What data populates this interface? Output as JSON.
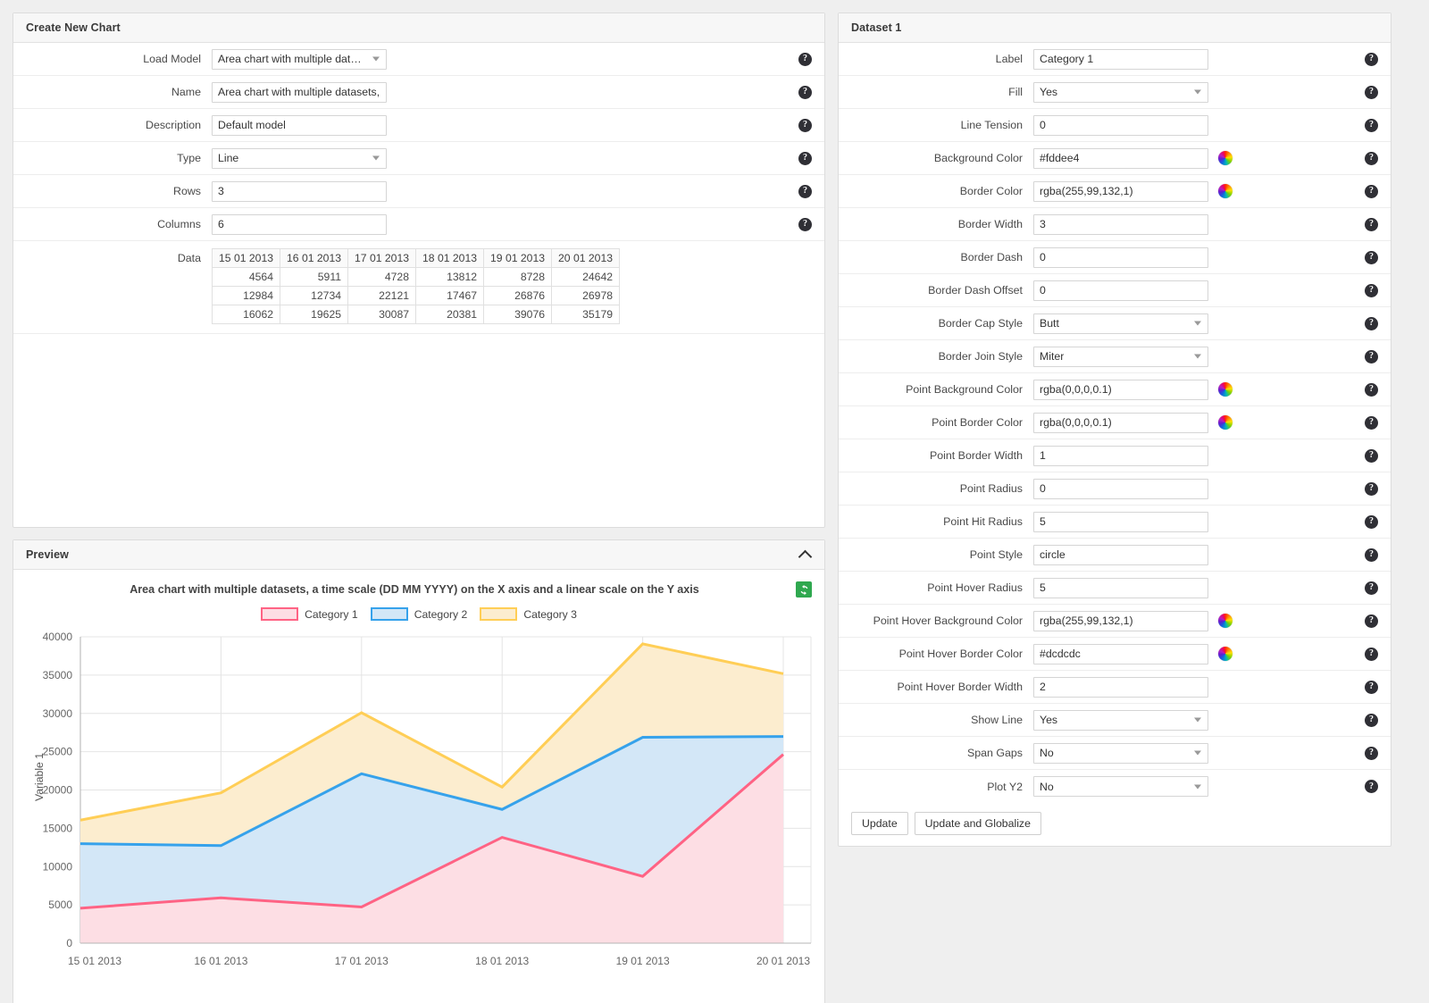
{
  "left_panel": {
    "title": "Create New Chart",
    "fields": [
      {
        "label": "Load Model",
        "value": "Area chart with multiple datase...",
        "control": "select"
      },
      {
        "label": "Name",
        "value": "Area chart with multiple datasets, a tim",
        "control": "input"
      },
      {
        "label": "Description",
        "value": "Default model",
        "control": "input"
      },
      {
        "label": "Type",
        "value": "Line",
        "control": "select"
      },
      {
        "label": "Rows",
        "value": "3",
        "control": "input"
      },
      {
        "label": "Columns",
        "value": "6",
        "control": "input"
      }
    ],
    "data_label": "Data",
    "help_icon": "question-mark-icon"
  },
  "data_table": {
    "headers": [
      "15 01 2013",
      "16 01 2013",
      "17 01 2013",
      "18 01 2013",
      "19 01 2013",
      "20 01 2013"
    ],
    "rows": [
      [
        "4564",
        "5911",
        "4728",
        "13812",
        "8728",
        "24642"
      ],
      [
        "12984",
        "12734",
        "22121",
        "17467",
        "26876",
        "26978"
      ],
      [
        "16062",
        "19625",
        "30087",
        "20381",
        "39076",
        "35179"
      ]
    ]
  },
  "preview": {
    "title": "Preview",
    "collapse_icon": "chevron-up-icon",
    "refresh_icon": "refresh-icon",
    "refresh_color": "#2fa84f"
  },
  "right_panel": {
    "title": "Dataset 1",
    "fields": [
      {
        "label": "Label",
        "value": "Category 1",
        "control": "input",
        "swatch": false
      },
      {
        "label": "Fill",
        "value": "Yes",
        "control": "select",
        "swatch": false
      },
      {
        "label": "Line Tension",
        "value": "0",
        "control": "input",
        "swatch": false
      },
      {
        "label": "Background Color",
        "value": "#fddee4",
        "control": "input",
        "swatch": true
      },
      {
        "label": "Border Color",
        "value": "rgba(255,99,132,1)",
        "control": "input",
        "swatch": true
      },
      {
        "label": "Border Width",
        "value": "3",
        "control": "input",
        "swatch": false
      },
      {
        "label": "Border Dash",
        "value": "0",
        "control": "input",
        "swatch": false
      },
      {
        "label": "Border Dash Offset",
        "value": "0",
        "control": "input",
        "swatch": false
      },
      {
        "label": "Border Cap Style",
        "value": "Butt",
        "control": "select",
        "swatch": false
      },
      {
        "label": "Border Join Style",
        "value": "Miter",
        "control": "select",
        "swatch": false
      },
      {
        "label": "Point Background Color",
        "value": "rgba(0,0,0,0.1)",
        "control": "input",
        "swatch": true
      },
      {
        "label": "Point Border Color",
        "value": "rgba(0,0,0,0.1)",
        "control": "input",
        "swatch": true
      },
      {
        "label": "Point Border Width",
        "value": "1",
        "control": "input",
        "swatch": false
      },
      {
        "label": "Point Radius",
        "value": "0",
        "control": "input",
        "swatch": false
      },
      {
        "label": "Point Hit Radius",
        "value": "5",
        "control": "input",
        "swatch": false
      },
      {
        "label": "Point Style",
        "value": "circle",
        "control": "input",
        "swatch": false
      },
      {
        "label": "Point Hover Radius",
        "value": "5",
        "control": "input",
        "swatch": false
      },
      {
        "label": "Point Hover Background Color",
        "value": "rgba(255,99,132,1)",
        "control": "input",
        "swatch": true
      },
      {
        "label": "Point Hover Border Color",
        "value": "#dcdcdc",
        "control": "input",
        "swatch": true
      },
      {
        "label": "Point Hover Border Width",
        "value": "2",
        "control": "input",
        "swatch": false
      },
      {
        "label": "Show Line",
        "value": "Yes",
        "control": "select",
        "swatch": false
      },
      {
        "label": "Span Gaps",
        "value": "No",
        "control": "select",
        "swatch": false
      },
      {
        "label": "Plot Y2",
        "value": "No",
        "control": "select",
        "swatch": false
      }
    ],
    "buttons": [
      {
        "label": "Update"
      },
      {
        "label": "Update and Globalize"
      }
    ]
  },
  "chart_data": {
    "type": "area",
    "title": "Area chart with multiple datasets, a time scale (DD MM YYYY) on the X axis and a linear scale on the Y axis",
    "xlabel": "",
    "ylabel": "Variable 1",
    "x": [
      "15 01 2013",
      "16 01 2013",
      "17 01 2013",
      "18 01 2013",
      "19 01 2013",
      "20 01 2013"
    ],
    "ylim": [
      0,
      40000
    ],
    "yticks": [
      0,
      5000,
      10000,
      15000,
      20000,
      25000,
      30000,
      35000,
      40000
    ],
    "grid": true,
    "legend_position": "top",
    "stacked": false,
    "series": [
      {
        "name": "Category 1",
        "values": [
          4564,
          5911,
          4728,
          13812,
          8728,
          24642
        ],
        "border_color": "rgba(255,99,132,1)",
        "fill_color": "#fddee4"
      },
      {
        "name": "Category 2",
        "values": [
          12984,
          12734,
          22121,
          17467,
          26876,
          26978
        ],
        "border_color": "rgba(54,162,235,1)",
        "fill_color": "#d3e7f7"
      },
      {
        "name": "Category 3",
        "values": [
          16062,
          19625,
          30087,
          20381,
          39076,
          35179
        ],
        "border_color": "rgba(255,206,86,1)",
        "fill_color": "#fcedcf"
      }
    ]
  }
}
